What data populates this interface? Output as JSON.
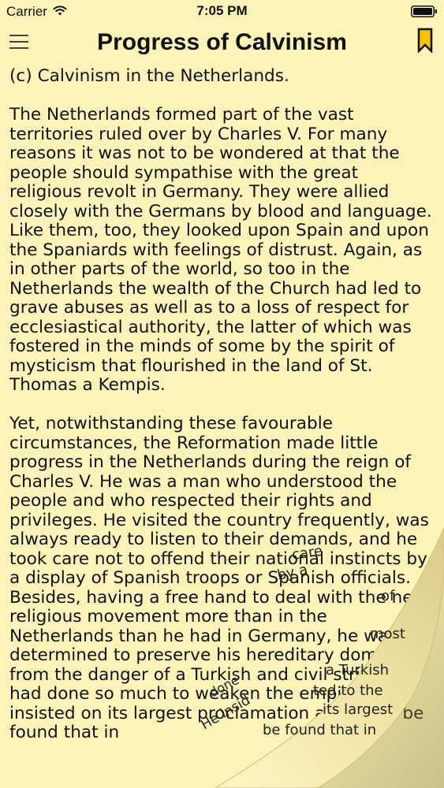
{
  "status_bar": {
    "carrier": "Carrier",
    "time": "7:05 PM",
    "icons": [
      "wifi-icon",
      "battery-icon"
    ]
  },
  "nav": {
    "title": "Progress of Calvinism",
    "menu_icon": "hamburger-menu-icon",
    "bookmark_icon": "bookmark-icon"
  },
  "content": {
    "heading": "(c) Calvinism in the Netherlands.",
    "paragraphs": [
      "The Netherlands formed part of the vast territories ruled over by Charles V. For many reasons it was not to be wondered at that the people should sympathise with the great religious revolt in Germany. They were allied closely with the Germans by blood and language. Like them, too, they looked upon Spain and upon the Spaniards with feelings of distrust. Again, as in other parts of the world, so too in the Netherlands the wealth of the Church had led to grave abuses as well as to a loss of respect for ecclesiastical authority, the latter of which was fostered in the minds of some by the spirit of mysticism that flourished in the land of St. Thomas a Kempis.",
      "Yet, notwithstanding these favourable circumstances, the Reformation made little progress in the Netherlands during the reign of Charles V. He was a man who understood the people and who respected their rights and privileges. He visited the country frequently, was always ready to listen to their demands, and he took care not to offend their national instincts by a display of Spanish troops or Spanish officials. Besides, having a free hand to deal with the new religious movement more than in the Netherlands than he had in Germany, he was determined to preserve his hereditary dominions from the danger of a Turkish and civil strife that had done so much to weaken the empire. He insisted on its largest proclamation and it will be found that in"
    ]
  },
  "page_curl": {
    "back_text": [
      "care",
      "by a",
      "se",
      "of",
      "s",
      "most",
      "of",
      "a Turkish",
      "ted to the",
      "its largest",
      "be found that in",
      "done",
      "He insid"
    ],
    "colors": {
      "page": "#fbf3b8",
      "curl_back": "#f1e6a9",
      "shadow": "#c9bd7e"
    }
  },
  "colors": {
    "background": "#fbf3b8",
    "text": "#111111",
    "bookmark": "#e0b800"
  }
}
